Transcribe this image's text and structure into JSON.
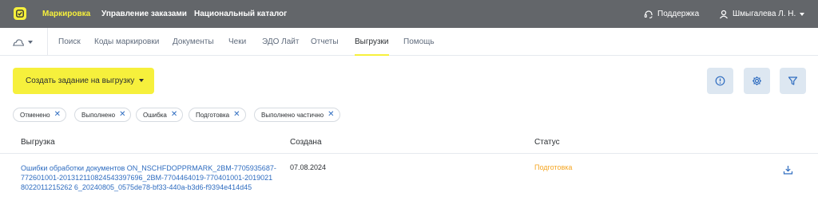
{
  "topbar": {
    "nav": [
      "Маркировка",
      "Управление заказами",
      "Национальный каталог"
    ],
    "active_index": 0,
    "support_label": "Поддержка",
    "user_label": "Шмыгалева Л. Н."
  },
  "subnav": {
    "tabs": [
      "Поиск",
      "Коды маркировки",
      "Документы",
      "Чеки",
      "ЭДО Лайт",
      "Отчеты",
      "Выгрузки",
      "Помощь"
    ],
    "active_index": 6
  },
  "actions": {
    "create_label": "Создать задание на выгрузку"
  },
  "filters": [
    "Отменено",
    "Выполнено",
    "Ошибка",
    "Подготовка",
    "Выполнено частично"
  ],
  "table": {
    "columns": [
      "Выгрузка",
      "Создана",
      "Статус"
    ],
    "rows": [
      {
        "name": "Ошибки обработки документов ON_NSCHFDOPPRMARK_2BM-7705935687-772601001-201312110824543397696_2BM-7704464019-770401001-20190218022011215262 6_20240805_0575de78-bf33-440a-b3d6-f9394e414d45",
        "created": "07.08.2024",
        "status": "Подготовка"
      }
    ]
  },
  "colors": {
    "topbar_bg": "#63666a",
    "accent_yellow": "#f6f03c",
    "link_blue": "#2e6cc0",
    "status_orange": "#f5a623"
  }
}
